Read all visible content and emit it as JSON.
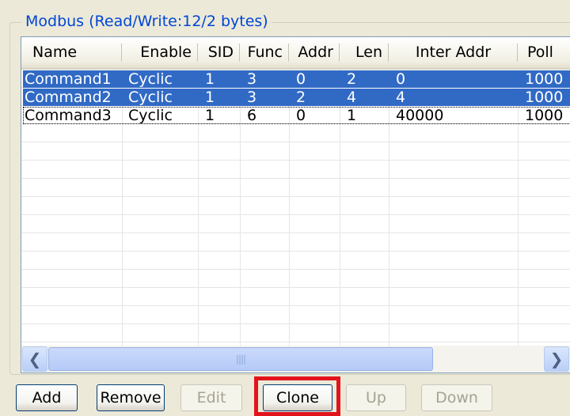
{
  "group": {
    "title": "Modbus (Read/Write:12/2 bytes)"
  },
  "table": {
    "columns": [
      "Name",
      "Enable",
      "SID",
      "Func",
      "Addr",
      "Len",
      "Inter Addr",
      "Poll"
    ],
    "rows": [
      {
        "cells": [
          "Command1",
          "Cyclic",
          "1",
          "3",
          "0",
          "2",
          "0",
          "1000"
        ],
        "selected": true
      },
      {
        "cells": [
          "Command2",
          "Cyclic",
          "1",
          "3",
          "2",
          "4",
          "4",
          "1000"
        ],
        "selected": true
      },
      {
        "cells": [
          "Command3",
          "Cyclic",
          "1",
          "6",
          "0",
          "1",
          "40000",
          "1000"
        ],
        "selected": false
      }
    ],
    "selection_color": "#316AC5"
  },
  "scrollbar": {
    "left_icon": "arrow-left-icon",
    "right_icon": "arrow-right-icon",
    "grip_icon": "grip-icon"
  },
  "buttons": {
    "add": "Add",
    "remove": "Remove",
    "edit": "Edit",
    "clone": "Clone",
    "up": "Up",
    "down": "Down"
  },
  "annotation": {
    "highlight_color": "#E3131B",
    "target": "clone"
  }
}
